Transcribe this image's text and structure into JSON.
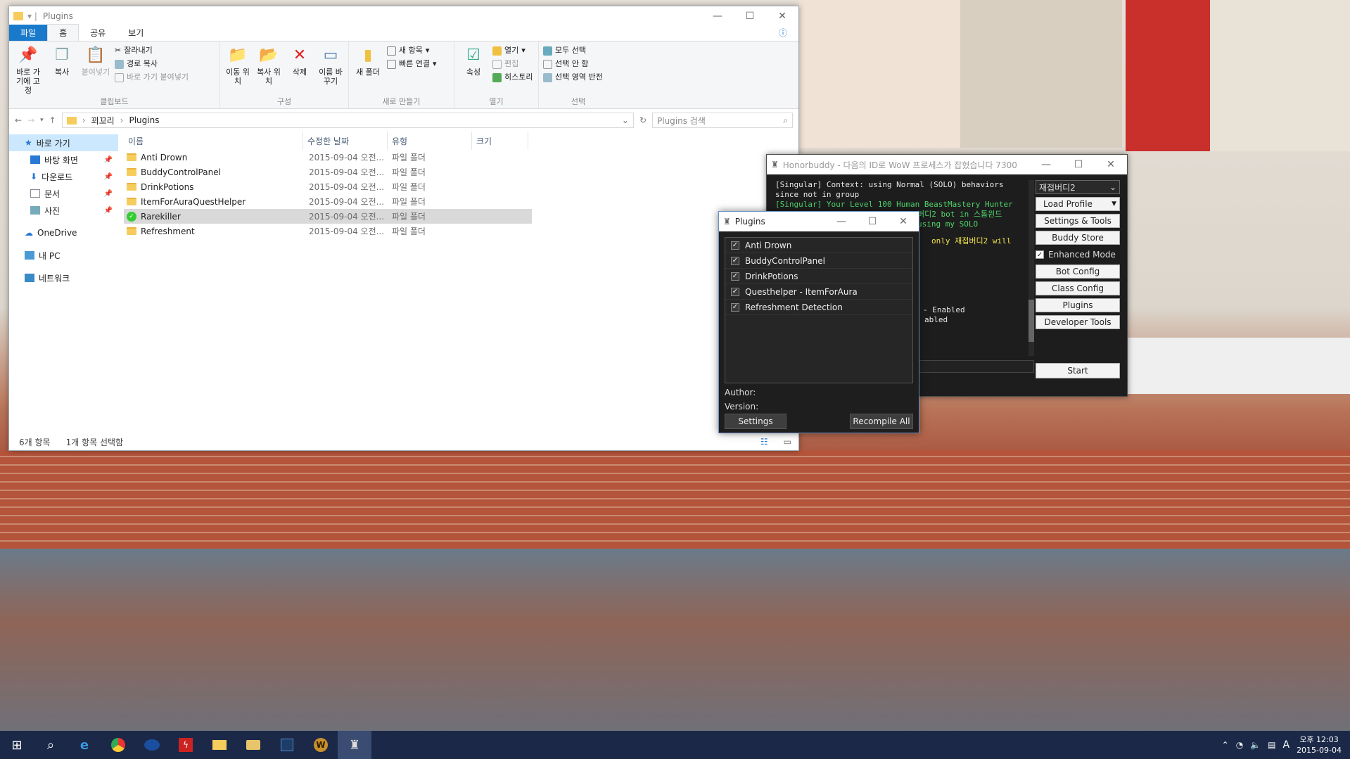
{
  "explorer": {
    "title": "Plugins",
    "tabs": [
      "파일",
      "홈",
      "공유",
      "보기"
    ],
    "ribbon": {
      "clipboard": {
        "pin_label": "바로 가기에 고정",
        "copy_label": "복사",
        "paste_label": "붙여넣기",
        "cut_label": "잘라내기",
        "copy_path_label": "경로 복사",
        "paste_shortcut_label": "바로 가기 붙여넣기",
        "group_label": "클립보드"
      },
      "organize": {
        "move_label": "이동 위치",
        "copyto_label": "복사 위치",
        "delete_label": "삭제",
        "rename_label": "이름 바꾸기",
        "group_label": "구성"
      },
      "new": {
        "new_folder_label": "새 폴더",
        "new_item_label": "새 항목",
        "easy_access_label": "빠른 연결",
        "group_label": "새로 만들기"
      },
      "open": {
        "properties_label": "속성",
        "open_label": "열기",
        "edit_label": "편집",
        "history_label": "히스토리",
        "group_label": "열기"
      },
      "select": {
        "select_all_label": "모두 선택",
        "select_none_label": "선택 안 함",
        "invert_label": "선택 영역 반전",
        "group_label": "선택"
      }
    },
    "breadcrumb": [
      "꾀꼬리",
      "Plugins"
    ],
    "search_placeholder": "Plugins 검색",
    "nav": {
      "quick_access": "바로 가기",
      "desktop": "바탕 화면",
      "downloads": "다운로드",
      "documents": "문서",
      "pictures": "사진",
      "onedrive": "OneDrive",
      "this_pc": "내 PC",
      "network": "네트워크"
    },
    "columns": [
      "이름",
      "수정한 날짜",
      "유형",
      "크기"
    ],
    "files": [
      {
        "name": "Anti Drown",
        "date": "2015-09-04 오전...",
        "type": "파일 폴더"
      },
      {
        "name": "BuddyControlPanel",
        "date": "2015-09-04 오전...",
        "type": "파일 폴더"
      },
      {
        "name": "DrinkPotions",
        "date": "2015-09-04 오전...",
        "type": "파일 폴더"
      },
      {
        "name": "ItemForAuraQuestHelper",
        "date": "2015-09-04 오전...",
        "type": "파일 폴더"
      },
      {
        "name": "Rarekiller",
        "date": "2015-09-04 오전...",
        "type": "파일 폴더"
      },
      {
        "name": "Refreshment",
        "date": "2015-09-04 오전...",
        "type": "파일 폴더"
      }
    ],
    "status": {
      "count": "6개 항목",
      "selected": "1개 항목 선택함"
    }
  },
  "honorbuddy": {
    "title": "Honorbuddy - 다음의 ID로 WoW 프로세스가 잡혔습니다 7300",
    "log": [
      {
        "text": "[Singular] Context: using Normal (SOLO) behaviors",
        "color": "w"
      },
      {
        "text": "since not in group",
        "color": "w"
      },
      {
        "text": "[Singular] Your Level 100 Human BeastMastery Hunter",
        "color": "g"
      },
      {
        "text": "버디2 bot in 스톰윈드",
        "color": "g"
      },
      {
        "text": "using my SOLO",
        "color": "g"
      },
      {
        "text": "only 재접버디2 will",
        "color": "y"
      },
      {
        "text": "- Enabled",
        "color": "w"
      },
      {
        "text": "abled",
        "color": "w"
      }
    ],
    "bot_select": "재접버디2",
    "load_profile": "Load Profile",
    "settings_tools": "Settings & Tools",
    "buddy_store": "Buddy Store",
    "enhanced_mode": "Enhanced Mode",
    "bot_config": "Bot Config",
    "class_config": "Class Config",
    "plugins": "Plugins",
    "developer_tools": "Developer Tools",
    "start": "Start"
  },
  "plugins_dialog": {
    "title": "Plugins",
    "items": [
      {
        "name": "Anti Drown",
        "checked": true
      },
      {
        "name": "BuddyControlPanel",
        "checked": true
      },
      {
        "name": "DrinkPotions",
        "checked": true
      },
      {
        "name": "Questhelper - ItemForAura",
        "checked": true
      },
      {
        "name": "Refreshment Detection",
        "checked": true
      }
    ],
    "author_label": "Author:",
    "version_label": "Version:",
    "settings_button": "Settings",
    "recompile_button": "Recompile All"
  },
  "taskbar": {
    "clock_time": "오후 12:03",
    "clock_date": "2015-09-04",
    "ime": "A"
  }
}
